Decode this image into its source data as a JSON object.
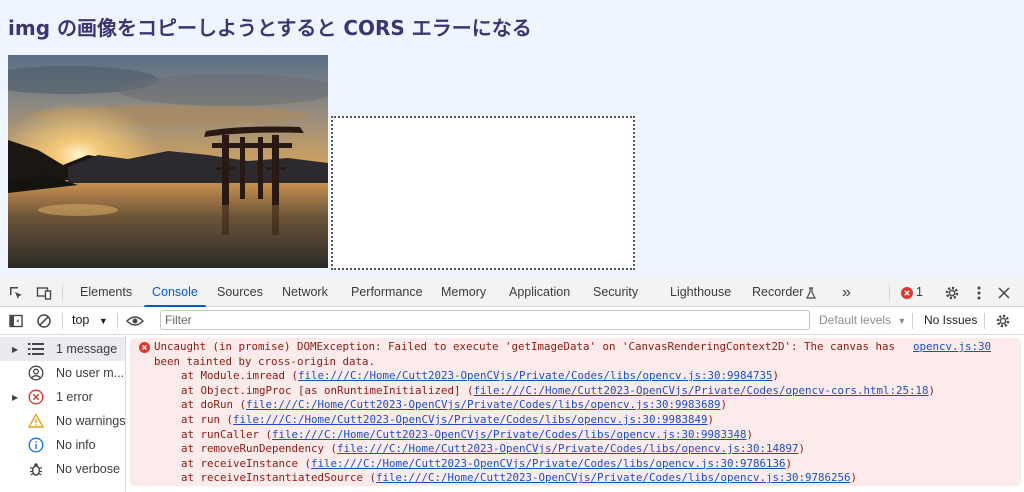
{
  "page": {
    "title": "img の画像をコピーしようとすると CORS エラーになる"
  },
  "devtools": {
    "tabs": [
      "Elements",
      "Console",
      "Sources",
      "Network",
      "Performance",
      "Memory",
      "Application",
      "Security",
      "Lighthouse",
      "Recorder"
    ],
    "active_tab": "Console",
    "more_tabs_label": "»",
    "error_count": "1",
    "toolbar": {
      "context": "top",
      "filter_placeholder": "Filter",
      "levels": "Default levels",
      "issues": "No Issues"
    },
    "sidebar": [
      {
        "label": "1 message",
        "icon": "list-icon"
      },
      {
        "label": "No user m...",
        "icon": "user-icon"
      },
      {
        "label": "1 error",
        "icon": "error-icon"
      },
      {
        "label": "No warnings",
        "icon": "warning-icon"
      },
      {
        "label": "No info",
        "icon": "info-icon"
      },
      {
        "label": "No verbose",
        "icon": "bug-icon"
      }
    ],
    "error": {
      "line1": "Uncaught (in promise) DOMException: Failed to execute 'getImageData' on 'CanvasRenderingContext2D': The canvas has ",
      "source": "opencv.js:30",
      "line2": "been tainted by cross-origin data.",
      "stack": [
        {
          "prefix": "at Module.imread (",
          "link": "file:///C:/Home/Cutt2023-OpenCVjs/Private/Codes/libs/opencv.js:30:9984735",
          "suffix": ")"
        },
        {
          "prefix": "at Object.imgProc [as onRuntimeInitialized] (",
          "link": "file:///C:/Home/Cutt2023-OpenCVjs/Private/Codes/opencv-cors.html:25:18",
          "suffix": ")"
        },
        {
          "prefix": "at doRun (",
          "link": "file:///C:/Home/Cutt2023-OpenCVjs/Private/Codes/libs/opencv.js:30:9983689",
          "suffix": ")"
        },
        {
          "prefix": "at run (",
          "link": "file:///C:/Home/Cutt2023-OpenCVjs/Private/Codes/libs/opencv.js:30:9983849",
          "suffix": ")"
        },
        {
          "prefix": "at runCaller (",
          "link": "file:///C:/Home/Cutt2023-OpenCVjs/Private/Codes/libs/opencv.js:30:9983348",
          "suffix": ")"
        },
        {
          "prefix": "at removeRunDependency (",
          "link": "file:///C:/Home/Cutt2023-OpenCVjs/Private/Codes/libs/opencv.js:30:14897",
          "suffix": ")"
        },
        {
          "prefix": "at receiveInstance (",
          "link": "file:///C:/Home/Cutt2023-OpenCVjs/Private/Codes/libs/opencv.js:30:9786136",
          "suffix": ")"
        },
        {
          "prefix": "at receiveInstantiatedSource (",
          "link": "file:///C:/Home/Cutt2023-OpenCVjs/Private/Codes/libs/opencv.js:30:9786256",
          "suffix": ")"
        }
      ]
    }
  },
  "colors": {
    "page_bg": "#eef5ff",
    "title": "#3b3572",
    "accent": "#0b57d0",
    "error_bg": "#fcebeb",
    "error_text": "#8b1a10",
    "error_red": "#dc362e"
  }
}
